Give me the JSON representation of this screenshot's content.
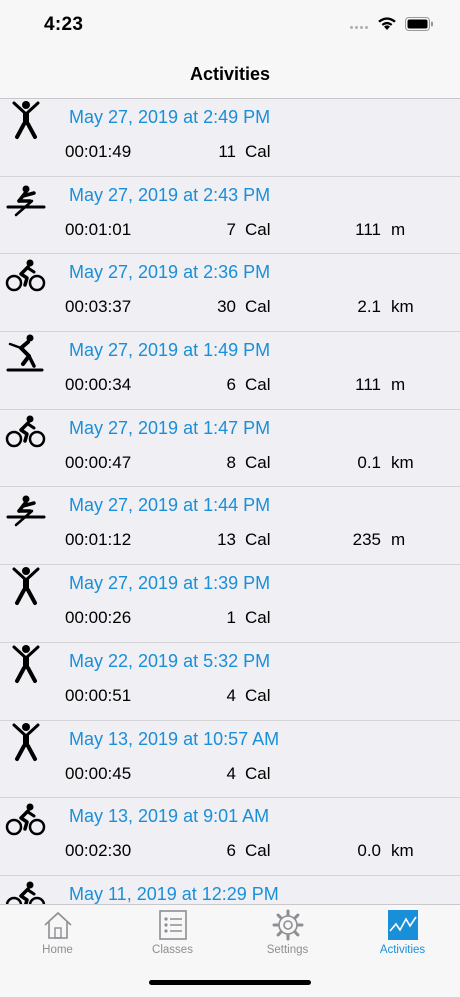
{
  "status": {
    "time": "4:23"
  },
  "nav": {
    "title": "Activities"
  },
  "activities": [
    {
      "icon": "jumping-jack-icon",
      "date": "May 27, 2019 at 2:49 PM",
      "time": "00:01:49",
      "cal": "11",
      "cal_unit": "Cal",
      "dist": "",
      "dist_unit": ""
    },
    {
      "icon": "rowing-icon",
      "date": "May 27, 2019 at 2:43 PM",
      "time": "00:01:01",
      "cal": "7",
      "cal_unit": "Cal",
      "dist": "111",
      "dist_unit": "m"
    },
    {
      "icon": "cycling-icon",
      "date": "May 27, 2019 at 2:36 PM",
      "time": "00:03:37",
      "cal": "30",
      "cal_unit": "Cal",
      "dist": "2.1",
      "dist_unit": "km"
    },
    {
      "icon": "skiing-icon",
      "date": "May 27, 2019 at 1:49 PM",
      "time": "00:00:34",
      "cal": "6",
      "cal_unit": "Cal",
      "dist": "111",
      "dist_unit": "m"
    },
    {
      "icon": "cycling-icon",
      "date": "May 27, 2019 at 1:47 PM",
      "time": "00:00:47",
      "cal": "8",
      "cal_unit": "Cal",
      "dist": "0.1",
      "dist_unit": "km"
    },
    {
      "icon": "rowing-icon",
      "date": "May 27, 2019 at 1:44 PM",
      "time": "00:01:12",
      "cal": "13",
      "cal_unit": "Cal",
      "dist": "235",
      "dist_unit": "m"
    },
    {
      "icon": "jumping-jack-icon",
      "date": "May 27, 2019 at 1:39 PM",
      "time": "00:00:26",
      "cal": "1",
      "cal_unit": "Cal",
      "dist": "",
      "dist_unit": ""
    },
    {
      "icon": "jumping-jack-icon",
      "date": "May 22, 2019 at 5:32 PM",
      "time": "00:00:51",
      "cal": "4",
      "cal_unit": "Cal",
      "dist": "",
      "dist_unit": ""
    },
    {
      "icon": "jumping-jack-icon",
      "date": "May 13, 2019 at 10:57 AM",
      "time": "00:00:45",
      "cal": "4",
      "cal_unit": "Cal",
      "dist": "",
      "dist_unit": ""
    },
    {
      "icon": "cycling-icon",
      "date": "May 13, 2019 at 9:01 AM",
      "time": "00:02:30",
      "cal": "6",
      "cal_unit": "Cal",
      "dist": "0.0",
      "dist_unit": "km"
    },
    {
      "icon": "cycling-icon",
      "date": "May 11, 2019 at 12:29 PM",
      "time": "",
      "cal": "",
      "cal_unit": "",
      "dist": "",
      "dist_unit": ""
    }
  ],
  "tabs": [
    {
      "label": "Home",
      "icon": "home-icon",
      "active": false
    },
    {
      "label": "Classes",
      "icon": "list-icon",
      "active": false
    },
    {
      "label": "Settings",
      "icon": "gear-icon",
      "active": false
    },
    {
      "label": "Activities",
      "icon": "activity-chart-icon",
      "active": true
    }
  ],
  "colors": {
    "accent": "#1a8fd9",
    "inactive": "#8e8e93"
  }
}
